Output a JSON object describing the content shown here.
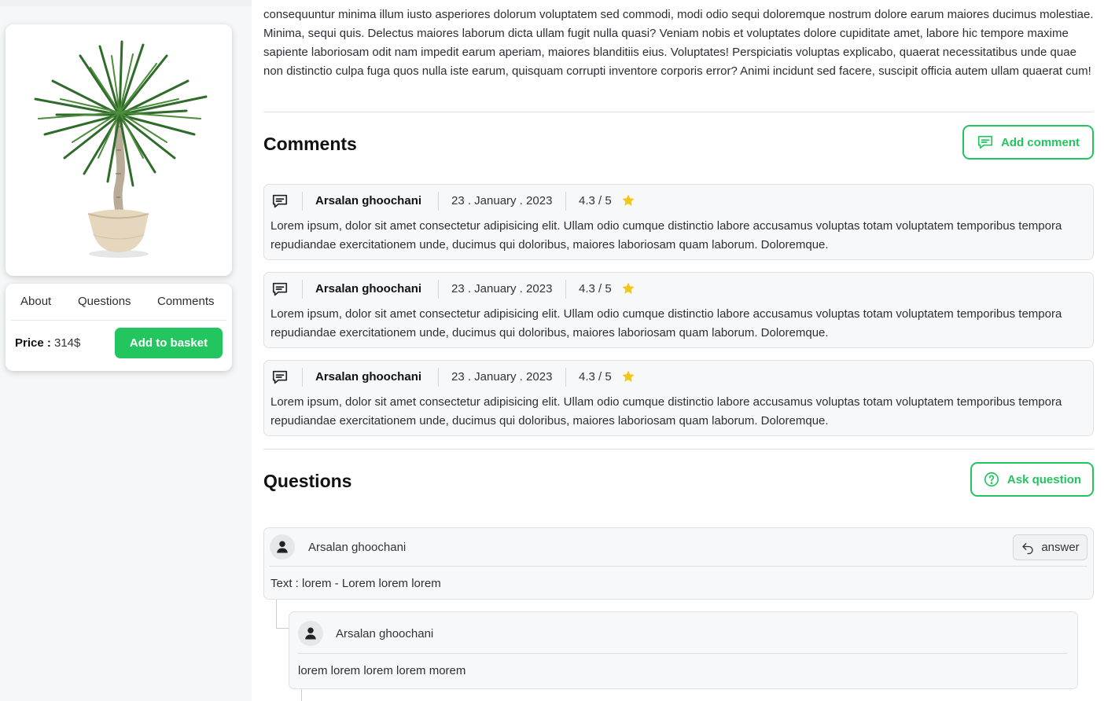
{
  "product": {
    "image_alt": "Potted palm plant",
    "tabs": [
      {
        "label": "About"
      },
      {
        "label": "Questions"
      },
      {
        "label": "Comments"
      }
    ],
    "price_label": "Price :",
    "price_value": "314$",
    "basket_button": "Add to basket"
  },
  "description": "consequuntur minima illum iusto asperiores dolorum voluptatem sed commodi, modi odio sequi doloremque nostrum dolore earum maiores ducimus molestiae. Minima, sequi quis. Delectus maiores laborum dicta ullam fugit nulla quasi? Veniam nobis et voluptates dolore cupiditate amet, labore hic tempore maxime sapiente laboriosam odit nam impedit earum aperiam, maiores blanditiis eius. Voluptates! Perspiciatis voluptas explicabo, quaerat necessitatibus unde quae non distinctio culpa fuga quos nulla iste earum, quisquam corrupti inventore corporis error? Animi incidunt sed facere, suscipit officia autem ullam quaerat cum!",
  "comments": {
    "title": "Comments",
    "add_button": "Add comment",
    "items": [
      {
        "author": "Arsalan ghoochani",
        "date": "23 . January . 2023",
        "rating": "4.3 / 5",
        "text": "Lorem ipsum, dolor sit amet consectetur adipisicing elit. Ullam odio cumque distinctio labore accusamus voluptas totam voluptatem temporibus tempora repudiandae exercitationem unde, ducimus qui doloribus, maiores laboriosam quam laborum. Doloremque."
      },
      {
        "author": "Arsalan ghoochani",
        "date": "23 . January . 2023",
        "rating": "4.3 / 5",
        "text": "Lorem ipsum, dolor sit amet consectetur adipisicing elit. Ullam odio cumque distinctio labore accusamus voluptas totam voluptatem temporibus tempora repudiandae exercitationem unde, ducimus qui doloribus, maiores laboriosam quam laborum. Doloremque."
      },
      {
        "author": "Arsalan ghoochani",
        "date": "23 . January . 2023",
        "rating": "4.3 / 5",
        "text": "Lorem ipsum, dolor sit amet consectetur adipisicing elit. Ullam odio cumque distinctio labore accusamus voluptas totam voluptatem temporibus tempora repudiandae exercitationem unde, ducimus qui doloribus, maiores laboriosam quam laborum. Doloremque."
      }
    ]
  },
  "questions": {
    "title": "Questions",
    "ask_button": "Ask question",
    "items": [
      {
        "author": "Arsalan ghoochani",
        "text": "Text : lorem - Lorem lorem lorem",
        "answer_button": "answer"
      }
    ],
    "replies": [
      {
        "author": "Arsalan ghoochani",
        "text": "lorem lorem lorem lorem morem"
      }
    ]
  },
  "colors": {
    "accent": "#22c55e",
    "star": "#f5c518"
  }
}
